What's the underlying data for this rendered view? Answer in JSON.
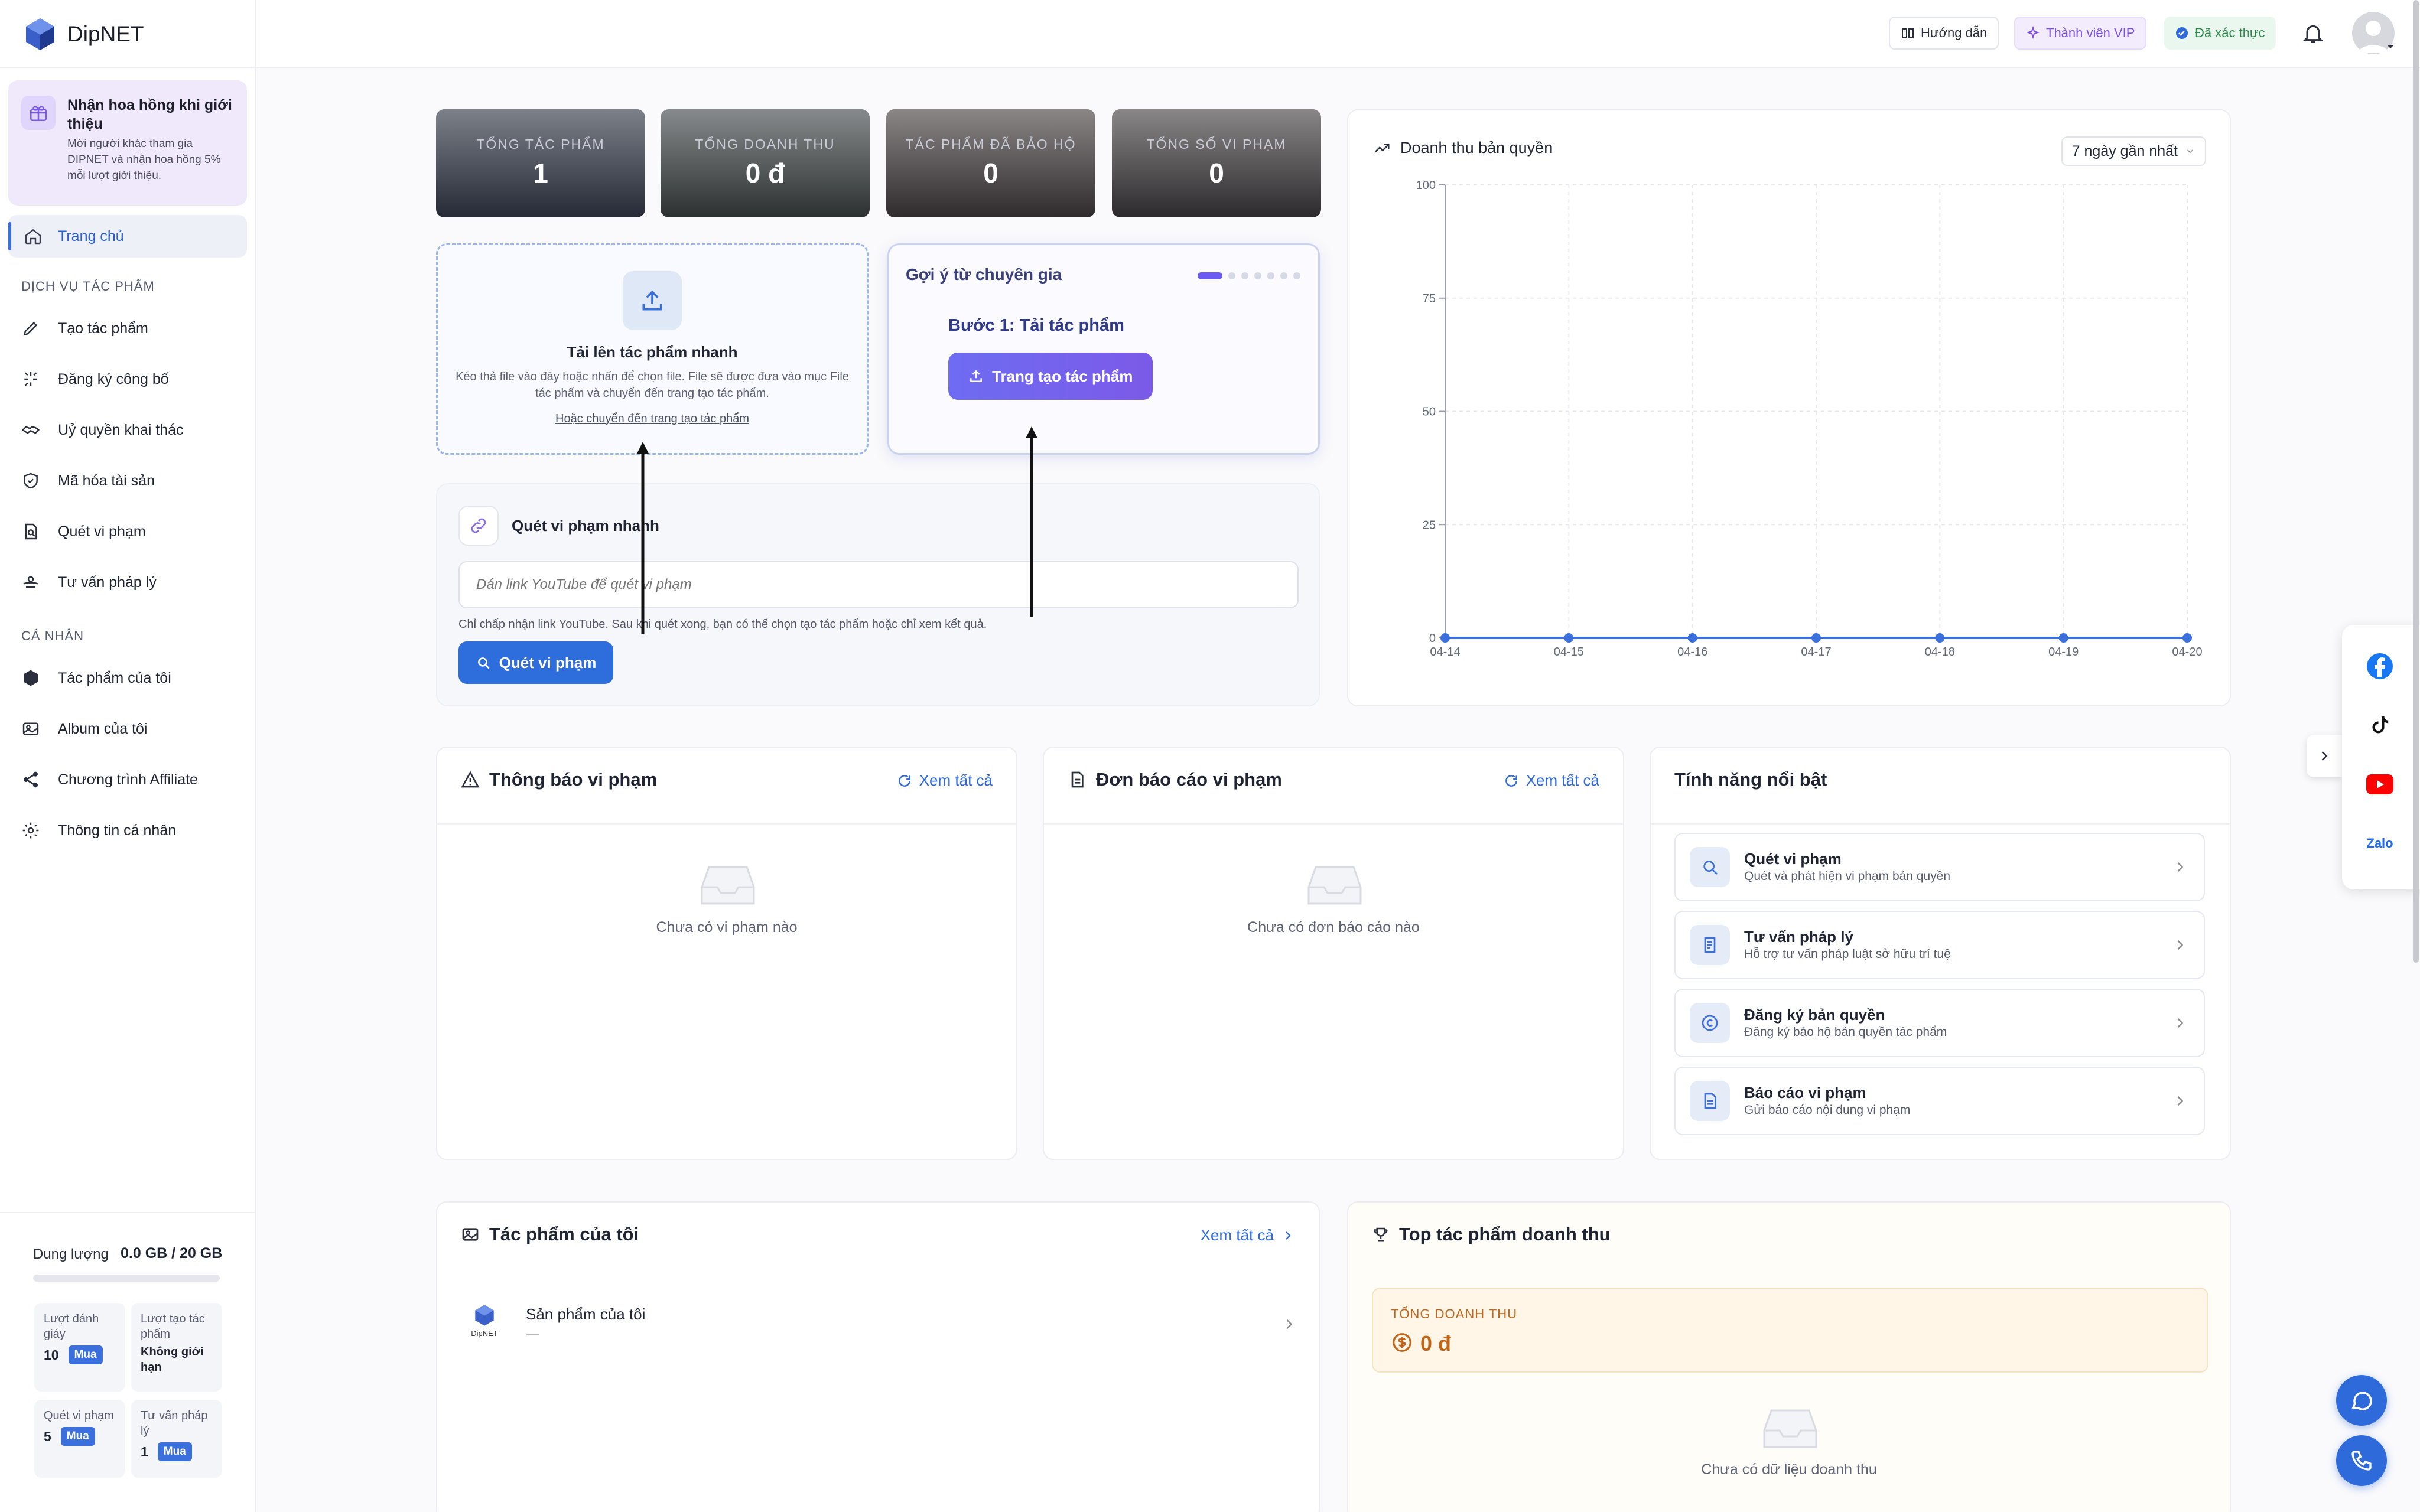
{
  "brand": {
    "name": "DipNET"
  },
  "header": {
    "guide": "Hướng dẫn",
    "vip": "Thành viên VIP",
    "verified": "Đã xác thực"
  },
  "sidebar": {
    "promo": {
      "title": "Nhận hoa hồng khi giới thiệu",
      "desc": "Mời người khác tham gia DIPNET và nhận hoa hồng 5% mỗi lượt giới thiệu."
    },
    "home": "Trang chủ",
    "section_services": "DỊCH VỤ TÁC PHẨM",
    "services": [
      {
        "label": "Tạo tác phẩm",
        "icon": "pencil-icon"
      },
      {
        "label": "Đăng ký công bố",
        "icon": "sparkle-icon"
      },
      {
        "label": "Uỷ quyền khai thác",
        "icon": "handshake-icon"
      },
      {
        "label": "Mã hóa tài sản",
        "icon": "shield-icon"
      },
      {
        "label": "Quét vi phạm",
        "icon": "doc-search-icon"
      },
      {
        "label": "Tư vấn pháp lý",
        "icon": "consult-icon"
      }
    ],
    "section_personal": "CÁ NHÂN",
    "personal": [
      {
        "label": "Tác phẩm của tôi",
        "icon": "cube-icon"
      },
      {
        "label": "Album của tôi",
        "icon": "album-icon"
      },
      {
        "label": "Chương trình Affiliate",
        "icon": "share-icon"
      },
      {
        "label": "Thông tin cá nhân",
        "icon": "gear-icon"
      }
    ],
    "storage": {
      "label": "Dung lượng",
      "value": "0.0 GB / 20 GB",
      "used_fraction": 0.0
    },
    "quotas": [
      {
        "label": "Lượt đánh giáy",
        "value": "10",
        "buy": "Mua"
      },
      {
        "label": "Lượt tạo tác phẩm",
        "value": "Không giới hạn"
      },
      {
        "label": "Quét vi phạm",
        "value": "5",
        "buy": "Mua"
      },
      {
        "label": "Tư vấn pháp lý",
        "value": "1",
        "buy": "Mua"
      }
    ]
  },
  "stats": [
    {
      "label": "TỔNG TÁC PHẨM",
      "value": "1"
    },
    {
      "label": "TỔNG DOANH THU",
      "value": "0 đ"
    },
    {
      "label": "TÁC PHẨM ĐÃ BẢO HỘ",
      "value": "0"
    },
    {
      "label": "TỔNG SỐ VI PHẠM",
      "value": "0"
    }
  ],
  "upload": {
    "title": "Tải lên tác phẩm nhanh",
    "desc": "Kéo thả file vào đây hoặc nhấn để chọn file. File sẽ được đưa vào mục File tác phẩm và chuyển đến trang tạo tác phẩm.",
    "link": "Hoặc chuyển đến trang tạo tác phẩm"
  },
  "expert": {
    "title": "Gợi ý từ chuyên gia",
    "step": "Bước 1: Tải tác phẩm",
    "button": "Trang tạo tác phẩm"
  },
  "scan": {
    "title": "Quét vi phạm nhanh",
    "placeholder": "Dán link YouTube để quét vi phạm",
    "note": "Chỉ chấp nhận link YouTube. Sau khi quét xong, bạn có thể chọn tạo tác phẩm hoặc chỉ xem kết quả.",
    "button": "Quét vi phạm"
  },
  "revenue": {
    "title": "Doanh thu bản quyền",
    "range": "7 ngày gần nhất"
  },
  "chart_data": {
    "type": "line",
    "x": [
      "04-14",
      "04-15",
      "04-16",
      "04-17",
      "04-18",
      "04-19",
      "04-20"
    ],
    "series": [
      {
        "values": [
          0,
          0,
          0,
          0,
          0,
          0,
          0
        ]
      }
    ],
    "yticks": [
      0,
      25,
      50,
      75,
      100
    ],
    "ylim": [
      0,
      100
    ],
    "grid": true,
    "color": "#3b6fdc"
  },
  "violations": {
    "title": "Thông báo vi phạm",
    "see_all": "Xem tất cả",
    "empty": "Chưa có vi phạm nào"
  },
  "reports": {
    "title": "Đơn báo cáo vi phạm",
    "see_all": "Xem tất cả",
    "empty": "Chưa có đơn báo cáo nào"
  },
  "features": {
    "title": "Tính năng nổi bật",
    "items": [
      {
        "title": "Quét vi phạm",
        "desc": "Quét và phát hiện vi phạm bản quyền",
        "icon": "search-icon"
      },
      {
        "title": "Tư vấn pháp lý",
        "desc": "Hỗ trợ tư vấn pháp luật sở hữu trí tuệ",
        "icon": "legal-doc-icon"
      },
      {
        "title": "Đăng ký bản quyền",
        "desc": "Đăng ký bảo hộ bản quyền tác phẩm",
        "icon": "copyright-icon"
      },
      {
        "title": "Báo cáo vi phạm",
        "desc": "Gửi báo cáo nội dung vi phạm",
        "icon": "report-icon"
      }
    ]
  },
  "my_works": {
    "title": "Tác phẩm của tôi",
    "see_all": "Xem tất cả",
    "items": [
      {
        "title": "Sản phẩm của tôi",
        "sub": "—",
        "thumb_text": "DipNET"
      }
    ]
  },
  "top_revenue": {
    "title": "Top tác phẩm doanh thu",
    "total_label": "TỔNG DOANH THU",
    "total_value": "0 đ",
    "empty": "Chưa có dữ liệu doanh thu"
  },
  "social": {
    "zalo": "Zalo"
  },
  "colors": {
    "accent": "#2f6ad8",
    "purple": "#6a5cf0",
    "brand_blue": "#3b6fdc"
  }
}
